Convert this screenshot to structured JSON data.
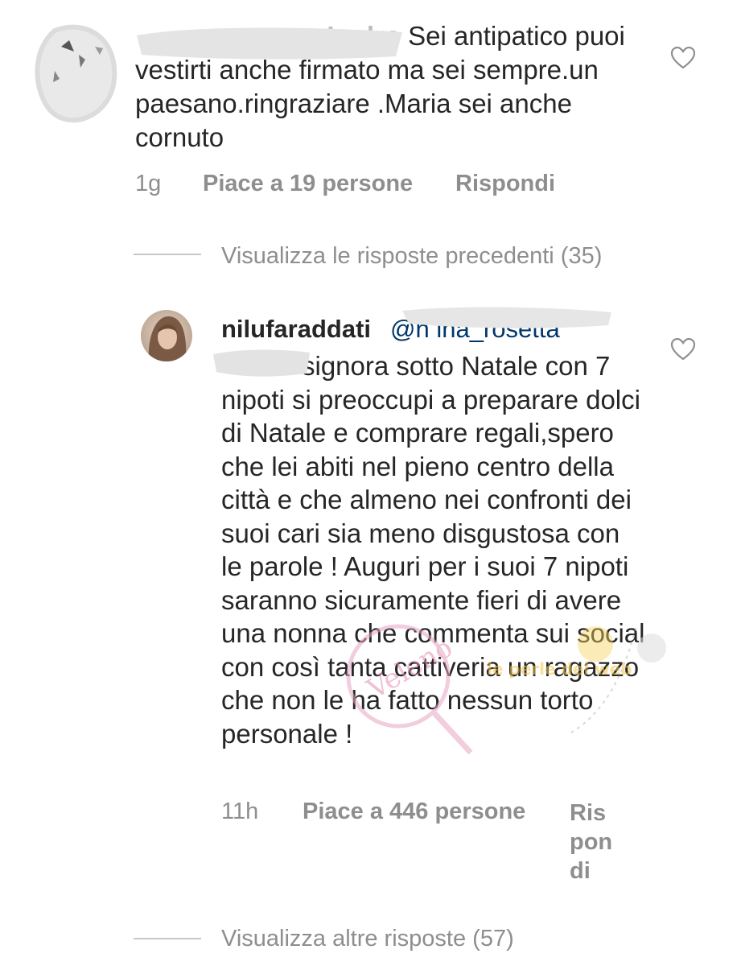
{
  "comments": [
    {
      "username": "_Ladro",
      "text": "Sei antipatico puoi vestirti anche firmato ma sei sempre.un paesano.ringraziare .Maria sei anche cornuto",
      "time": "1g",
      "likes": "Piace a 19 persone",
      "reply_label": "Rispondi"
    }
  ],
  "view_previous": "Visualizza le risposte precedenti (35)",
  "reply": {
    "username": "nilufaraddati",
    "mention": "@n   ina_rosetta",
    "text": "signora sotto Natale con 7 nipoti si preoccupi a preparare dolci di Natale e comprare regali,spero che lei abiti nel pieno centro della città e che almeno nei confronti dei suoi cari sia meno disgustosa con le parole ! Auguri per i suoi 7 nipoti saranno sicuramente fieri di avere una nonna che commenta sui social con così tanta cattiveria un ragazzo che non le ha fatto nessun torto personale !",
    "time": "11h",
    "likes": "Piace a 446 persone",
    "reply_label": "Rispondi"
  },
  "view_more": "Visualizza altre risposte (57)",
  "watermark": {
    "left_text": "Veleno delle Vetrine",
    "right_text": "le perle del web"
  },
  "colors": {
    "text": "#262626",
    "secondary": "#8e8e8e",
    "mention": "#00376b"
  }
}
